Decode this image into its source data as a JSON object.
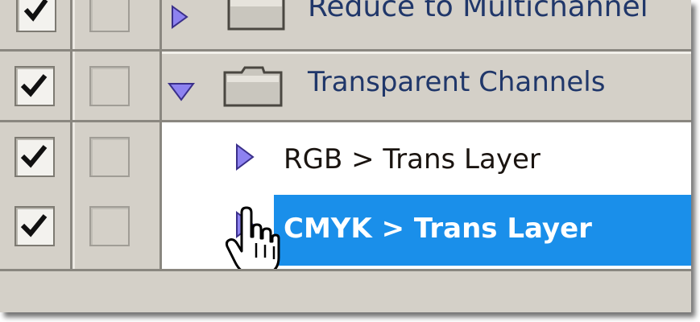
{
  "actions_panel": {
    "rows": [
      {
        "label": "Reduce to Multichannel",
        "checked": true,
        "expanded": false,
        "type": "set"
      },
      {
        "label": "Transparent Channels",
        "checked": true,
        "expanded": true,
        "type": "set"
      },
      {
        "label": "RGB > Trans Layer",
        "checked": true,
        "expanded": false,
        "type": "action"
      },
      {
        "label": "CMYK > Trans Layer",
        "checked": true,
        "expanded": false,
        "type": "action",
        "selected": true
      }
    ]
  },
  "colors": {
    "panel_bg": "#d4d0c8",
    "selection": "#1a8fea",
    "triangle": "#7b6fe0",
    "text": "#1a1410"
  }
}
